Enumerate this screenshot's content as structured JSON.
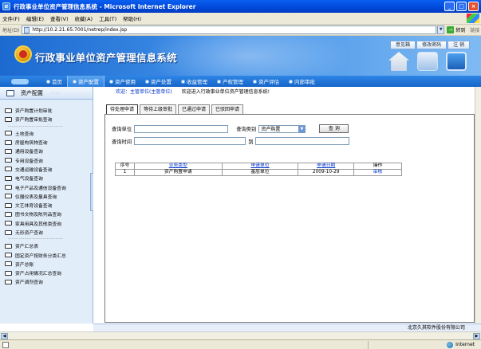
{
  "window": {
    "title": "行政事业单位资产管理信息系统 - Microsoft Internet Explorer",
    "buttons": [
      "_",
      "□",
      "×"
    ]
  },
  "menubar": [
    "文件(F)",
    "编辑(E)",
    "查看(V)",
    "收藏(A)",
    "工具(T)",
    "帮助(H)"
  ],
  "address": {
    "label": "地址(D)",
    "url": "http://10.2.21.65:7001/netrep/index.jsp",
    "go_label": "转到",
    "links_label": "链接"
  },
  "header": {
    "title": "行政事业单位资产管理信息系统",
    "links": [
      "意见箱",
      "修改密码",
      "注 销"
    ],
    "icons": [
      "home-icon",
      "swap-icon",
      "save-icon"
    ]
  },
  "nav": {
    "user_label": "",
    "home": "首页",
    "items": [
      "资产配置",
      "资产使用",
      "资产处置",
      "收益管理",
      "产权管理",
      "资产评估",
      "内部审批"
    ],
    "active_index": 0
  },
  "sidebar": {
    "header": "资产配置",
    "grip": "::::",
    "group1": [
      "资产购置计划审批",
      "资产购置审批查询"
    ],
    "separator": "------------------------------",
    "group2": [
      "土地查询",
      "房屋构筑物查询",
      "通用设备查询",
      "专用设备查询",
      "交通运输设备查询",
      "电气设备查询",
      "电子产品及通信设备查询",
      "仪器仪表及量具查询",
      "文艺体育设备查询",
      "图书文物及陈列品查询",
      "家具用具及其他类查询",
      "无形资产查询"
    ],
    "group3": [
      "资产汇总表",
      "固定资产按财务分类汇总",
      "资产总账",
      "资产占用情况汇总查询",
      "资产调剂查询"
    ]
  },
  "main": {
    "welcome_dept": "欢迎：主管单位(主管单位)",
    "welcome_msg": "欢迎进入行政事业单位资产管理信息系统!",
    "tabs": [
      "待处理申请",
      "等待上级审批",
      "已通过申请",
      "已驳回申请"
    ],
    "active_tab": 0,
    "form": {
      "unit_label": "查询单位",
      "unit_value": "",
      "type_label": "查询类别",
      "type_value": "资产购置",
      "query_button": "查 询",
      "time_label": "查询时间",
      "time_from": "",
      "time_to_label": "到",
      "time_to": ""
    },
    "table": {
      "columns": [
        "序号",
        "业务类型",
        "申请单位",
        "申请日期",
        "操作"
      ],
      "rows": [
        [
          "1",
          "资产购置申请",
          "基层单位",
          "2009-10-29",
          "审核"
        ]
      ]
    }
  },
  "footer": {
    "company": "北京久其软件股份有限公司"
  },
  "statusbar": {
    "zone": "Internet"
  }
}
